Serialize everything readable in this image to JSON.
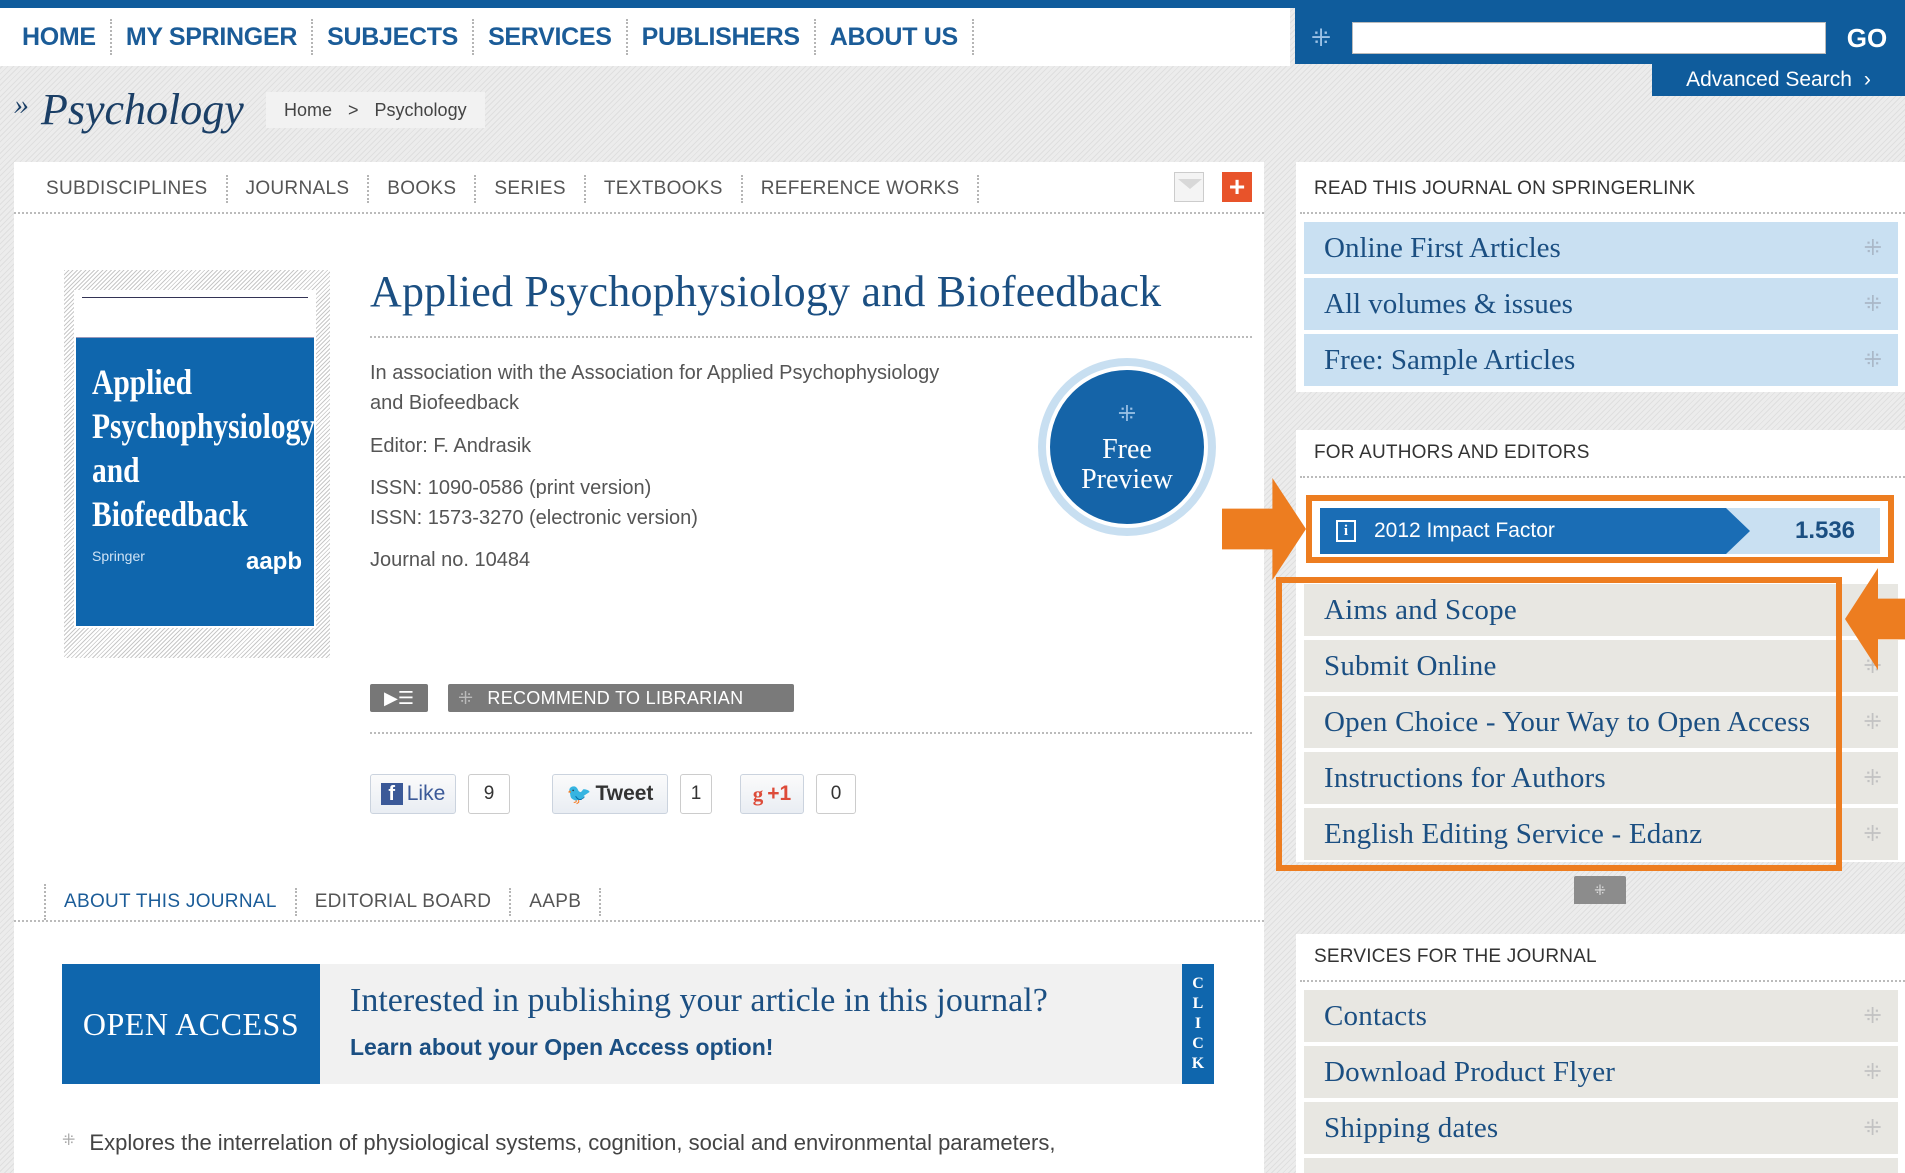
{
  "topnav": [
    "HOME",
    "MY SPRINGER",
    "SUBJECTS",
    "SERVICES",
    "PUBLISHERS",
    "ABOUT US"
  ],
  "search": {
    "go_label": "GO",
    "advanced_label": "Advanced Search",
    "value": ""
  },
  "section_title": "Psychology",
  "breadcrumb": [
    "Home",
    ">",
    "Psychology"
  ],
  "subnav": [
    "SUBDISCIPLINES",
    "JOURNALS",
    "BOOKS",
    "SERIES",
    "TEXTBOOKS",
    "REFERENCE WORKS"
  ],
  "cover": {
    "title_lines": [
      "Applied",
      "Psychophysiology",
      "and Biofeedback"
    ],
    "publisher": "Springer",
    "partner": "aapb"
  },
  "journal": {
    "title": "Applied Psychophysiology and Biofeedback",
    "association": "In association with the Association for Applied Psychophysiology and Biofeedback",
    "association_l1": "In association with the Association for Applied Psychophysiology",
    "association_l2": "and Biofeedback",
    "editor": "Editor: F. Andrasik",
    "issn_print": "ISSN: 1090-0586 (print version)",
    "issn_electronic": "ISSN: 1573-3270 (electronic version)",
    "journal_no": "Journal no. 10484"
  },
  "free_preview": {
    "line1": "Free",
    "line2": "Preview"
  },
  "recommend_label": "RECOMMEND TO LIBRARIAN",
  "social": {
    "like_label": "Like",
    "like_count": "9",
    "tweet_label": "Tweet",
    "tweet_count": "1",
    "gplus_label": "+1",
    "gplus_count": "0"
  },
  "about_tabs": [
    "ABOUT THIS JOURNAL",
    "EDITORIAL BOARD",
    "AAPB"
  ],
  "open_access": {
    "left_label": "OPEN ACCESS",
    "headline": "Interested in publishing your article in this journal?",
    "subline": "Learn about your Open Access option!",
    "click_letters": [
      "C",
      "L",
      "I",
      "C",
      "K"
    ]
  },
  "description": "Explores the interrelation of physiological systems, cognition, social and environmental parameters,",
  "sidebar": {
    "read_heading": "READ THIS JOURNAL ON SPRINGERLINK",
    "read_items": [
      "Online First Articles",
      "All volumes & issues",
      "Free: Sample Articles"
    ],
    "authors_heading": "FOR AUTHORS AND EDITORS",
    "impact_label": "2012 Impact Factor",
    "impact_value": "1.536",
    "author_items": [
      "Aims and Scope",
      "Submit Online",
      "Open Choice - Your Way to Open Access",
      "Instructions for Authors",
      "English Editing Service - Edanz"
    ],
    "services_heading": "SERVICES FOR THE JOURNAL",
    "service_items": [
      "Contacts",
      "Download Product Flyer",
      "Shipping dates"
    ]
  },
  "colors": {
    "brand_blue": "#0f66ad",
    "link_blue": "#1b5c98",
    "light_blue": "#c9e0f2",
    "annotation_orange": "#ed7d20",
    "share_red": "#e8532a"
  },
  "icons": [
    "search-icon",
    "mail-icon",
    "add-icon",
    "info-icon",
    "toc-icon",
    "dotted-arrow-icon"
  ]
}
